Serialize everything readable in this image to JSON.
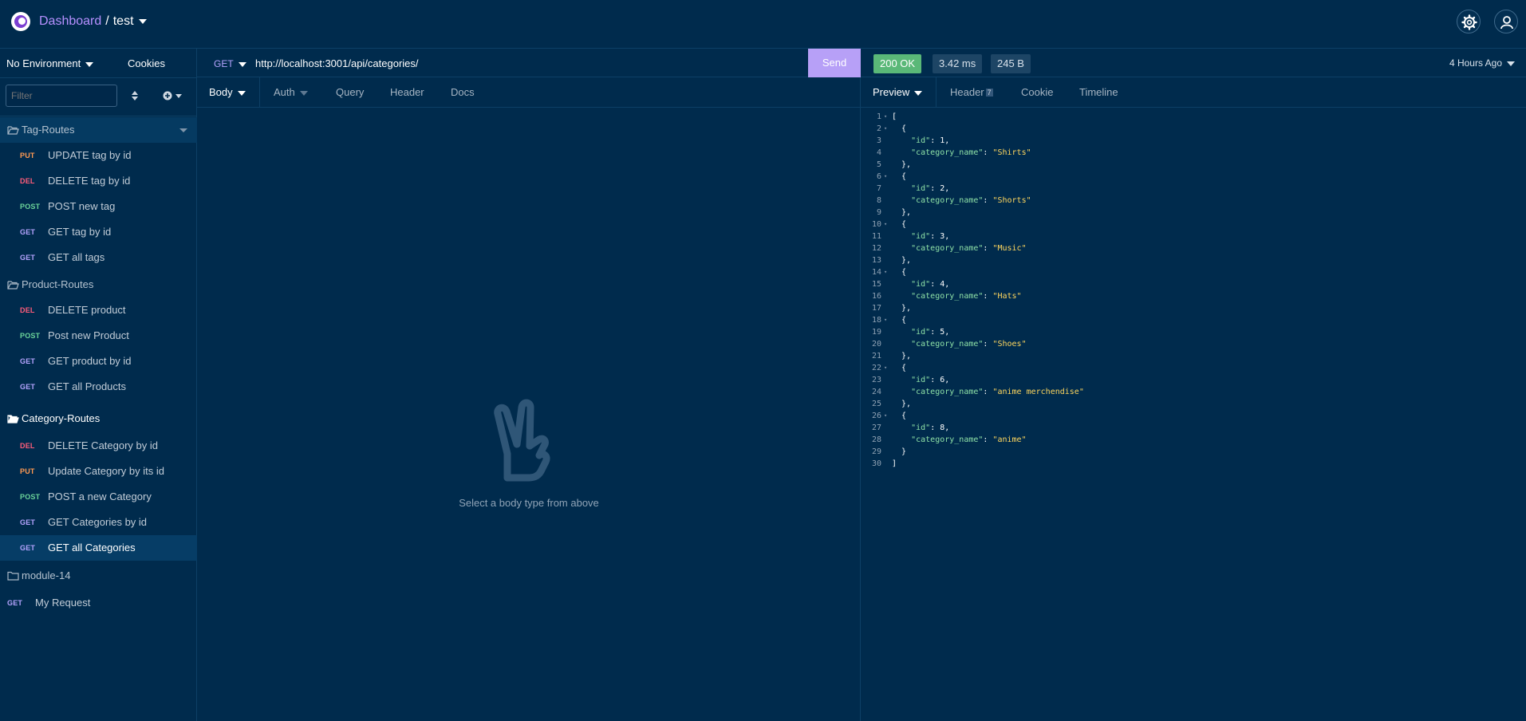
{
  "header": {
    "dashboard": "Dashboard",
    "separator": "/",
    "workspace": "test"
  },
  "sidebar": {
    "environment": "No Environment",
    "cookies": "Cookies",
    "filter_placeholder": "Filter",
    "tag_routes": {
      "name": "Tag-Routes",
      "items": [
        {
          "method": "PUT",
          "label": "UPDATE tag by id"
        },
        {
          "method": "DEL",
          "label": "DELETE tag by id"
        },
        {
          "method": "POST",
          "label": "POST new tag"
        },
        {
          "method": "GET",
          "label": "GET tag by id"
        },
        {
          "method": "GET",
          "label": "GET all tags"
        }
      ]
    },
    "product_routes": {
      "name": "Product-Routes",
      "items": [
        {
          "method": "DEL",
          "label": "DELETE product"
        },
        {
          "method": "POST",
          "label": "Post new Product"
        },
        {
          "method": "GET",
          "label": "GET product by id"
        },
        {
          "method": "GET",
          "label": "GET all Products"
        }
      ]
    },
    "category_routes": {
      "name": "Category-Routes",
      "items": [
        {
          "method": "DEL",
          "label": "DELETE Category by id"
        },
        {
          "method": "PUT",
          "label": "Update Category by its id"
        },
        {
          "method": "POST",
          "label": "POST a new Category"
        },
        {
          "method": "GET",
          "label": "GET Categories by id"
        },
        {
          "method": "GET",
          "label": "GET all Categories"
        }
      ]
    },
    "module": {
      "name": "module-14"
    },
    "loose_request": {
      "method": "GET",
      "label": "My Request"
    }
  },
  "request": {
    "method": "GET",
    "url": "http://localhost:3001/api/categories/",
    "send_label": "Send",
    "tabs": [
      "Body",
      "Auth",
      "Query",
      "Header",
      "Docs"
    ],
    "empty_message": "Select a body type from above"
  },
  "response": {
    "status": "200 OK",
    "time": "3.42 ms",
    "size": "245 B",
    "ago": "4 Hours Ago",
    "tabs": [
      "Preview",
      "Header",
      "Cookie",
      "Timeline"
    ],
    "header_count": "7",
    "body": [
      {
        "id": 1,
        "category_name": "Shirts"
      },
      {
        "id": 2,
        "category_name": "Shorts"
      },
      {
        "id": 3,
        "category_name": "Music"
      },
      {
        "id": 4,
        "category_name": "Hats"
      },
      {
        "id": 5,
        "category_name": "Shoes"
      },
      {
        "id": 6,
        "category_name": "anime merchendise"
      },
      {
        "id": 8,
        "category_name": "anime"
      }
    ]
  },
  "colors": {
    "background": "#002b4d",
    "accent": "#b690ff",
    "send_button": "#b7a0f7",
    "status_ok": "#5ab878"
  },
  "icons": [
    "app-logo-icon",
    "caret-down-icon",
    "settings-gear-icon",
    "user-account-icon",
    "folder-icon",
    "sort-icon",
    "plus-circle-icon",
    "peace-hand-icon"
  ]
}
